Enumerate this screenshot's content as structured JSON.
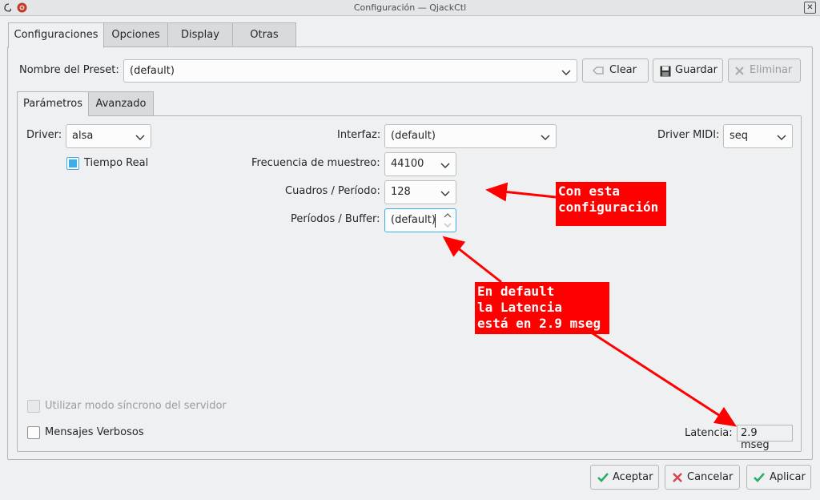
{
  "window": {
    "title": "Configuración — QjackCtl"
  },
  "main_tabs": [
    "Configuraciones",
    "Opciones",
    "Display",
    "Otras"
  ],
  "preset": {
    "label": "Nombre del Preset:",
    "value": "(default)",
    "clear_label": "Clear",
    "save_label": "Guardar",
    "delete_label": "Eliminar"
  },
  "sub_tabs": [
    "Parámetros",
    "Avanzado"
  ],
  "params": {
    "driver_label": "Driver:",
    "driver_value": "alsa",
    "realtime_label": "Tiempo Real",
    "interface_label": "Interfaz:",
    "interface_value": "(default)",
    "midi_label": "Driver MIDI:",
    "midi_value": "seq",
    "samplerate_label": "Frecuencia de muestreo:",
    "samplerate_value": "44100",
    "frames_label": "Cuadros / Período:",
    "frames_value": "128",
    "periods_label": "Períodos / Buffer:",
    "periods_value": "(default)",
    "sync_label": "Utilizar modo síncrono del servidor",
    "verbose_label": "Mensajes Verbosos",
    "latency_label": "Latencia:",
    "latency_value": "2.9 mseg"
  },
  "annotations": {
    "config_note": "Con esta\nconfiguración",
    "latency_note": "En default\nla Latencia\nestá en 2.9 mseg"
  },
  "footer": {
    "accept_label": "Aceptar",
    "cancel_label": "Cancelar",
    "apply_label": "Aplicar"
  },
  "colors": {
    "accent": "#3daee9",
    "annotation": "#ff0000",
    "background": "#eff0f1"
  },
  "icons": [
    "debian-icon",
    "qjackctl-icon",
    "close-icon",
    "clear-icon",
    "save-icon",
    "delete-icon",
    "chevron-down-icon",
    "spin-up-icon",
    "spin-down-icon",
    "accept-icon",
    "cancel-icon",
    "apply-icon"
  ]
}
